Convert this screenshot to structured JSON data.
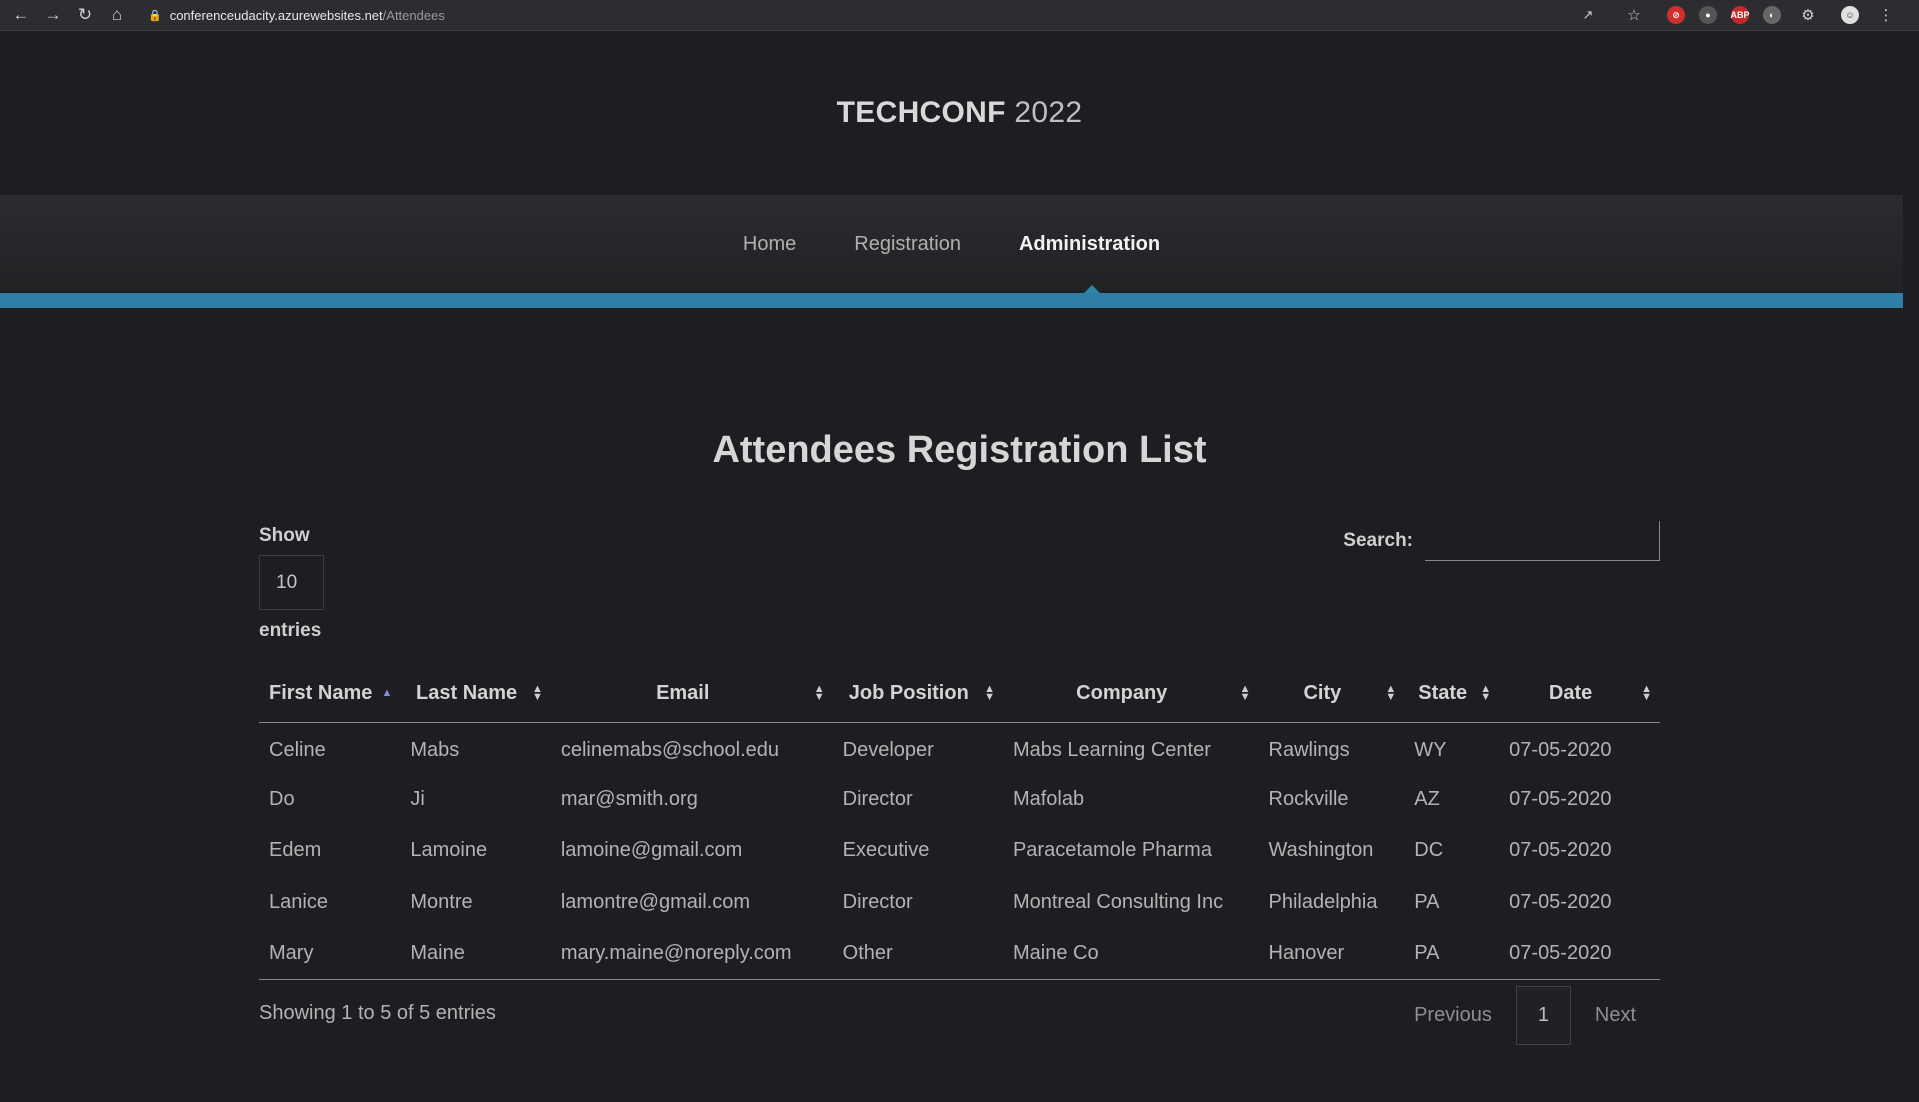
{
  "browser": {
    "url_host": "conferenceudacity.azurewebsites.net",
    "url_path": "/Attendees"
  },
  "brand": {
    "strong": "TECHCONF",
    "light": "2022"
  },
  "nav": {
    "home": "Home",
    "registration": "Registration",
    "administration": "Administration"
  },
  "page": {
    "title": "Attendees Registration List"
  },
  "length": {
    "show": "Show",
    "value": "10",
    "entries": "entries"
  },
  "search": {
    "label": "Search:",
    "value": ""
  },
  "table": {
    "headers": [
      "First Name",
      "Last Name",
      "Email",
      "Job Position",
      "Company",
      "City",
      "State",
      "Date"
    ],
    "rows": [
      [
        "Celine",
        "Mabs",
        "celinemabs@school.edu",
        "Developer",
        "Mabs Learning Center",
        "Rawlings",
        "WY",
        "07-05-2020"
      ],
      [
        "Do",
        "Ji",
        "mar@smith.org",
        "Director",
        "Mafolab",
        "Rockville",
        "AZ",
        "07-05-2020"
      ],
      [
        "Edem",
        "Lamoine",
        "lamoine@gmail.com",
        "Executive",
        "Paracetamole Pharma",
        "Washington",
        "DC",
        "07-05-2020"
      ],
      [
        "Lanice",
        "Montre",
        "lamontre@gmail.com",
        "Director",
        "Montreal Consulting Inc",
        "Philadelphia",
        "PA",
        "07-05-2020"
      ],
      [
        "Mary",
        "Maine",
        "mary.maine@noreply.com",
        "Other",
        "Maine Co",
        "Hanover",
        "PA",
        "07-05-2020"
      ]
    ]
  },
  "footer": {
    "info": "Showing 1 to 5 of 5 entries",
    "previous": "Previous",
    "current_page": "1",
    "next": "Next"
  },
  "colors": {
    "accent": "#2e7ea6",
    "background": "#1c1e21"
  }
}
